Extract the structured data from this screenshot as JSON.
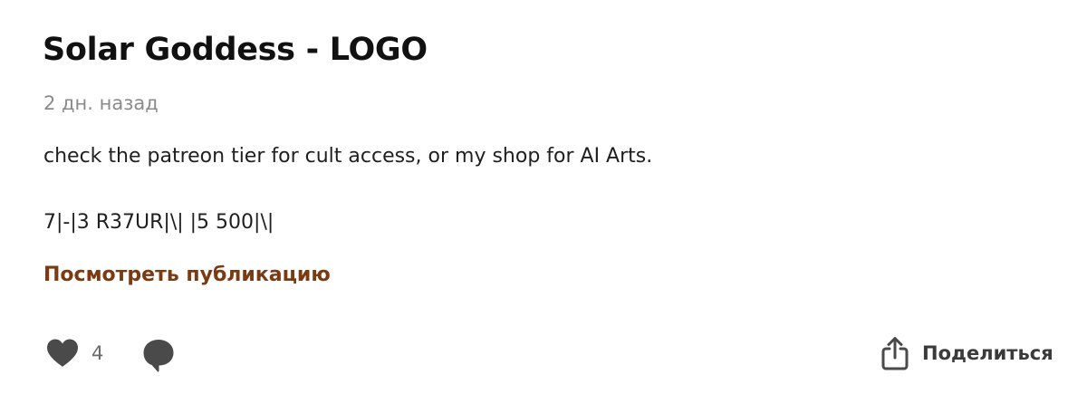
{
  "post": {
    "title": "Solar Goddess - LOGO",
    "timestamp": "2 дн. назад",
    "body_lines": [
      "check the patreon tier for cult access, or my shop for AI Arts.",
      "7|-|3 R37UR|\\| |5 500|\\|"
    ],
    "view_link_label": "Посмотреть публикацию"
  },
  "actions": {
    "like_icon": "heart-icon",
    "like_count": "4",
    "comment_icon": "comment-bubble-icon",
    "share_icon": "share-icon",
    "share_label": "Поделиться"
  },
  "colors": {
    "link": "#7a3a12",
    "icon": "#4a4a4a",
    "muted_text": "#8a8a8a"
  }
}
